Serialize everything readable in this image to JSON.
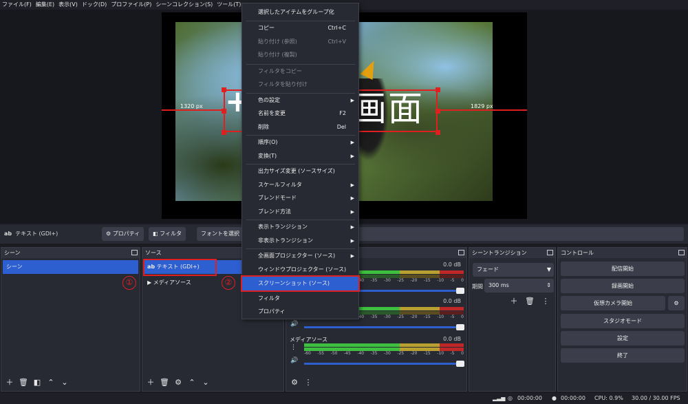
{
  "menubar": [
    "ファイル(F)",
    "編集(E)",
    "表示(V)",
    "ドック(D)",
    "プロファイル(P)",
    "シーンコレクション(S)",
    "ツール(T)"
  ],
  "preview": {
    "overlay_text": "画面",
    "overlay_plus": "+",
    "left_distance": "1320 px",
    "right_distance": "1829 px"
  },
  "source_toolbar": {
    "source_name": "テキスト (GDI+)",
    "source_icon": "ab",
    "properties": "プロパティ",
    "filters": "フィルタ",
    "select_font": "フォントを選択"
  },
  "scenes": {
    "title": "シーン",
    "items": [
      "シーン"
    ]
  },
  "sources": {
    "title": "ソース",
    "items": [
      {
        "icon": "ab",
        "label": "テキスト (GDI+)"
      },
      {
        "icon": "▶",
        "label": "メディアソース"
      }
    ]
  },
  "mixer": {
    "tracks": [
      {
        "name": "",
        "db": "0.0 dB"
      },
      {
        "name": "",
        "db": "0.0 dB"
      },
      {
        "name": "メディアソース",
        "db": "0.0 dB"
      }
    ],
    "scale": [
      "-60",
      "-55",
      "-50",
      "-45",
      "-40",
      "-35",
      "-30",
      "-25",
      "-20",
      "-15",
      "-10",
      "-5",
      "0"
    ]
  },
  "transitions": {
    "title": "シーントランジション",
    "type": "フェード",
    "duration_label": "期間",
    "duration": "300 ms"
  },
  "controls": {
    "title": "コントロール",
    "buttons": [
      "配信開始",
      "録画開始",
      "仮想カメラ開始",
      "スタジオモード",
      "設定",
      "終了"
    ]
  },
  "status": {
    "rec_time": "00:00:00",
    "stream_time": "00:00:00",
    "cpu": "CPU: 0.9%",
    "fps": "30.00 / 30.00 FPS"
  },
  "context_menu": {
    "items": [
      {
        "label": "選択したアイテムをグループ化",
        "shortcut": "",
        "disabled": false,
        "submenu": false
      },
      {
        "label": "コピー",
        "shortcut": "Ctrl+C",
        "disabled": false,
        "submenu": false
      },
      {
        "label": "貼り付け (参照)",
        "shortcut": "Ctrl+V",
        "disabled": true,
        "submenu": false
      },
      {
        "label": "貼り付け (複製)",
        "shortcut": "",
        "disabled": true,
        "submenu": false
      },
      {
        "label": "フィルタをコピー",
        "shortcut": "",
        "disabled": true,
        "submenu": false
      },
      {
        "label": "フィルタを貼り付け",
        "shortcut": "",
        "disabled": true,
        "submenu": false
      },
      {
        "label": "色の設定",
        "shortcut": "",
        "disabled": false,
        "submenu": true
      },
      {
        "label": "名前を変更",
        "shortcut": "F2",
        "disabled": false,
        "submenu": false
      },
      {
        "label": "削除",
        "shortcut": "Del",
        "disabled": false,
        "submenu": false
      },
      {
        "label": "順序(O)",
        "shortcut": "",
        "disabled": false,
        "submenu": true
      },
      {
        "label": "変換(T)",
        "shortcut": "",
        "disabled": false,
        "submenu": true
      },
      {
        "label": "出力サイズ変更 (ソースサイズ)",
        "shortcut": "",
        "disabled": false,
        "submenu": false
      },
      {
        "label": "スケールフィルタ",
        "shortcut": "",
        "disabled": false,
        "submenu": true
      },
      {
        "label": "ブレンドモード",
        "shortcut": "",
        "disabled": false,
        "submenu": true
      },
      {
        "label": "ブレンド方法",
        "shortcut": "",
        "disabled": false,
        "submenu": true
      },
      {
        "label": "表示トランジション",
        "shortcut": "",
        "disabled": false,
        "submenu": true
      },
      {
        "label": "非表示トランジション",
        "shortcut": "",
        "disabled": false,
        "submenu": true
      },
      {
        "label": "全画面プロジェクター (ソース)",
        "shortcut": "",
        "disabled": false,
        "submenu": true
      },
      {
        "label": "ウィンドウプロジェクター (ソース)",
        "shortcut": "",
        "disabled": false,
        "submenu": false
      },
      {
        "label": "スクリーンショット (ソース)",
        "shortcut": "",
        "disabled": false,
        "submenu": false
      },
      {
        "label": "フィルタ",
        "shortcut": "",
        "disabled": false,
        "submenu": false
      },
      {
        "label": "プロパティ",
        "shortcut": "",
        "disabled": false,
        "submenu": false
      }
    ]
  },
  "annotations": [
    "①",
    "②"
  ],
  "colors": {
    "accent": "#2e5fd1",
    "annotation": "#e02020",
    "panel": "#272a33"
  }
}
